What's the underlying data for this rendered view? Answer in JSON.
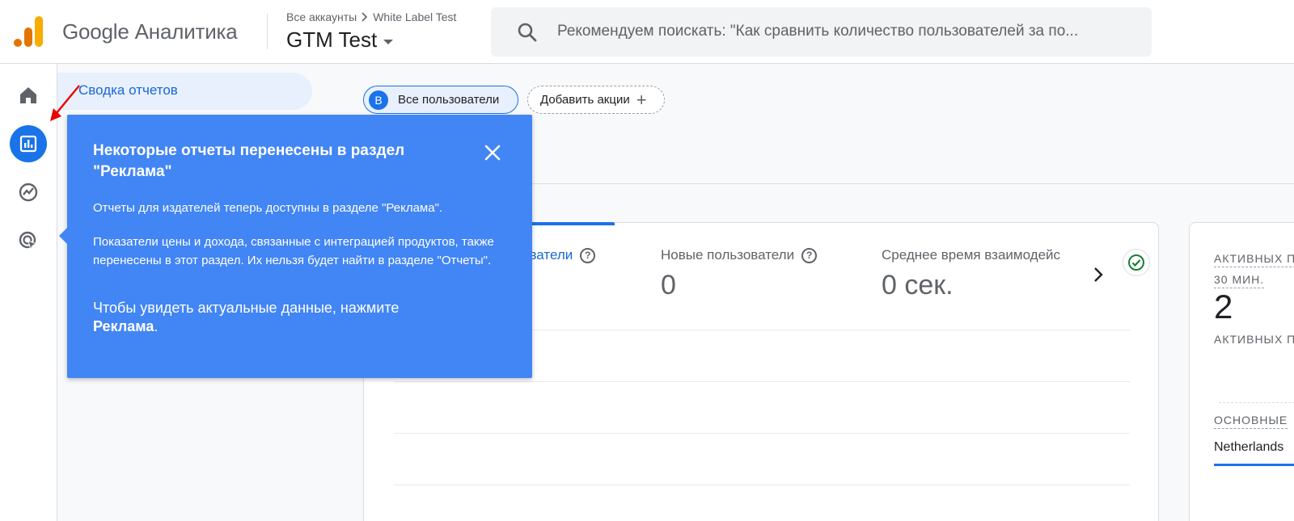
{
  "header": {
    "brand": "Google Аналитика",
    "breadcrumb_root": "Все аккаунты",
    "breadcrumb_account": "White Label Test",
    "property": "GTM Test",
    "search_placeholder": "Рекомендуем поискать: \"Как сравнить количество пользователей за по..."
  },
  "nav": {
    "active_item": "Сводка отчетов"
  },
  "rail": {
    "items": [
      {
        "icon": "home-icon"
      },
      {
        "icon": "reports-bar-chart-icon",
        "active": true
      },
      {
        "icon": "explore-icon"
      },
      {
        "icon": "advertising-icon"
      }
    ]
  },
  "toolbar": {
    "segment_badge": "В",
    "segment_label": "Все пользователи",
    "add_comparison": "Добавить акции"
  },
  "metrics_card": {
    "metric_1_label": "ователи",
    "metric_2_label": "Новые пользователи",
    "metric_2_value": "0",
    "metric_3_label": "Среднее время взаимодейс",
    "metric_3_value": "0 сек."
  },
  "realtime_card": {
    "label_1": "АКТИВНЫХ П",
    "label_1b": "30 МИН.",
    "value": "2",
    "label_2": "АКТИВНЫХ П",
    "label_3": "ОСНОВНЫЕ",
    "country": "Netherlands"
  },
  "popup": {
    "title": "Некоторые отчеты перенесены в раздел \"Реклама\"",
    "p1": "Отчеты для издателей теперь доступны в разделе \"Реклама\".",
    "p2": "Показатели цены и дохода, связанные с интеграцией продуктов, также перенесены в этот раздел. Их нельзя будет найти в разделе \"Отчеты\".",
    "p3_prefix": "Чтобы увидеть актуальные данные, нажмите",
    "p3_bold": "Реклама",
    "p3_suffix": "."
  },
  "colors": {
    "accent": "#1a73e8",
    "popup_bg": "#4285f4",
    "logo_orange": "#f9ab00",
    "logo_dark_orange": "#e37400",
    "annotation_red": "#ea0000",
    "check_green": "#188038"
  }
}
